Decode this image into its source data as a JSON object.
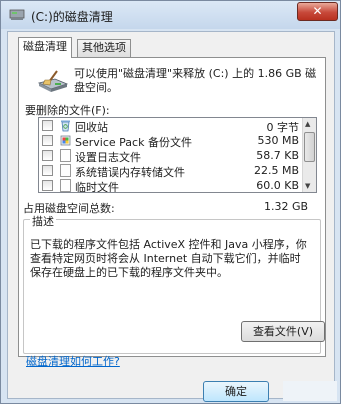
{
  "window": {
    "title": "(C:)的磁盘清理",
    "close_label": "✕"
  },
  "tabs": [
    {
      "label": "磁盘清理",
      "active": true
    },
    {
      "label": "其他选项",
      "active": false
    }
  ],
  "summary_line1": "可以使用\"磁盘清理\"来释放  (C:) 上的 1.86 GB 磁",
  "summary_line2": "盘空间。",
  "files_label": "要删除的文件(F):",
  "files": [
    {
      "name": "回收站",
      "size": "0 字节",
      "icon": "recycle-bin-icon",
      "checked": false
    },
    {
      "name": "Service Pack 备份文件",
      "size": "530 MB",
      "icon": "service-pack-icon",
      "checked": false
    },
    {
      "name": "设置日志文件",
      "size": "58.7 KB",
      "icon": "file-icon",
      "checked": false
    },
    {
      "name": "系统错误内存转储文件",
      "size": "22.5 MB",
      "icon": "file-icon",
      "checked": false
    },
    {
      "name": "临时文件",
      "size": "60.0 KB",
      "icon": "file-icon",
      "checked": false
    }
  ],
  "total_label": "占用磁盘空间总数:",
  "total_value": "1.32 GB",
  "description": {
    "legend": "描述",
    "line1": "已下载的程序文件包括 ActiveX 控件和 Java 小程序，你",
    "line2": "查看特定网页时将会从 Internet 自动下载它们，并临时",
    "line3": "保存在硬盘上的已下载的程序文件夹中。"
  },
  "view_files_label": "查看文件(V)",
  "help_link": "磁盘清理如何工作?",
  "ok_label": "确定"
}
